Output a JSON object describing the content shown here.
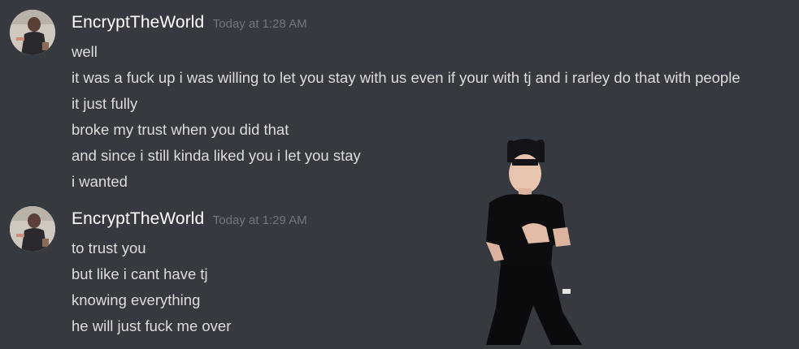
{
  "messages": [
    {
      "author": "EncryptTheWorld",
      "timestamp": "Today at 1:28 AM",
      "lines": [
        "well",
        "it was a fuck up i was willing to let you stay with us even if your with tj and i rarley do that with people",
        "it just fully",
        "broke my trust when you did that",
        "and since i still kinda liked you i let you stay",
        "i wanted"
      ]
    },
    {
      "author": "EncryptTheWorld",
      "timestamp": "Today at 1:29 AM",
      "lines": [
        "to trust you",
        "but like i cant have tj",
        "knowing everything",
        "he will just fuck me over"
      ]
    }
  ],
  "colors": {
    "background": "#36393f",
    "username": "#ffffff",
    "timestamp": "#72767d",
    "message_text": "#dcddde"
  }
}
